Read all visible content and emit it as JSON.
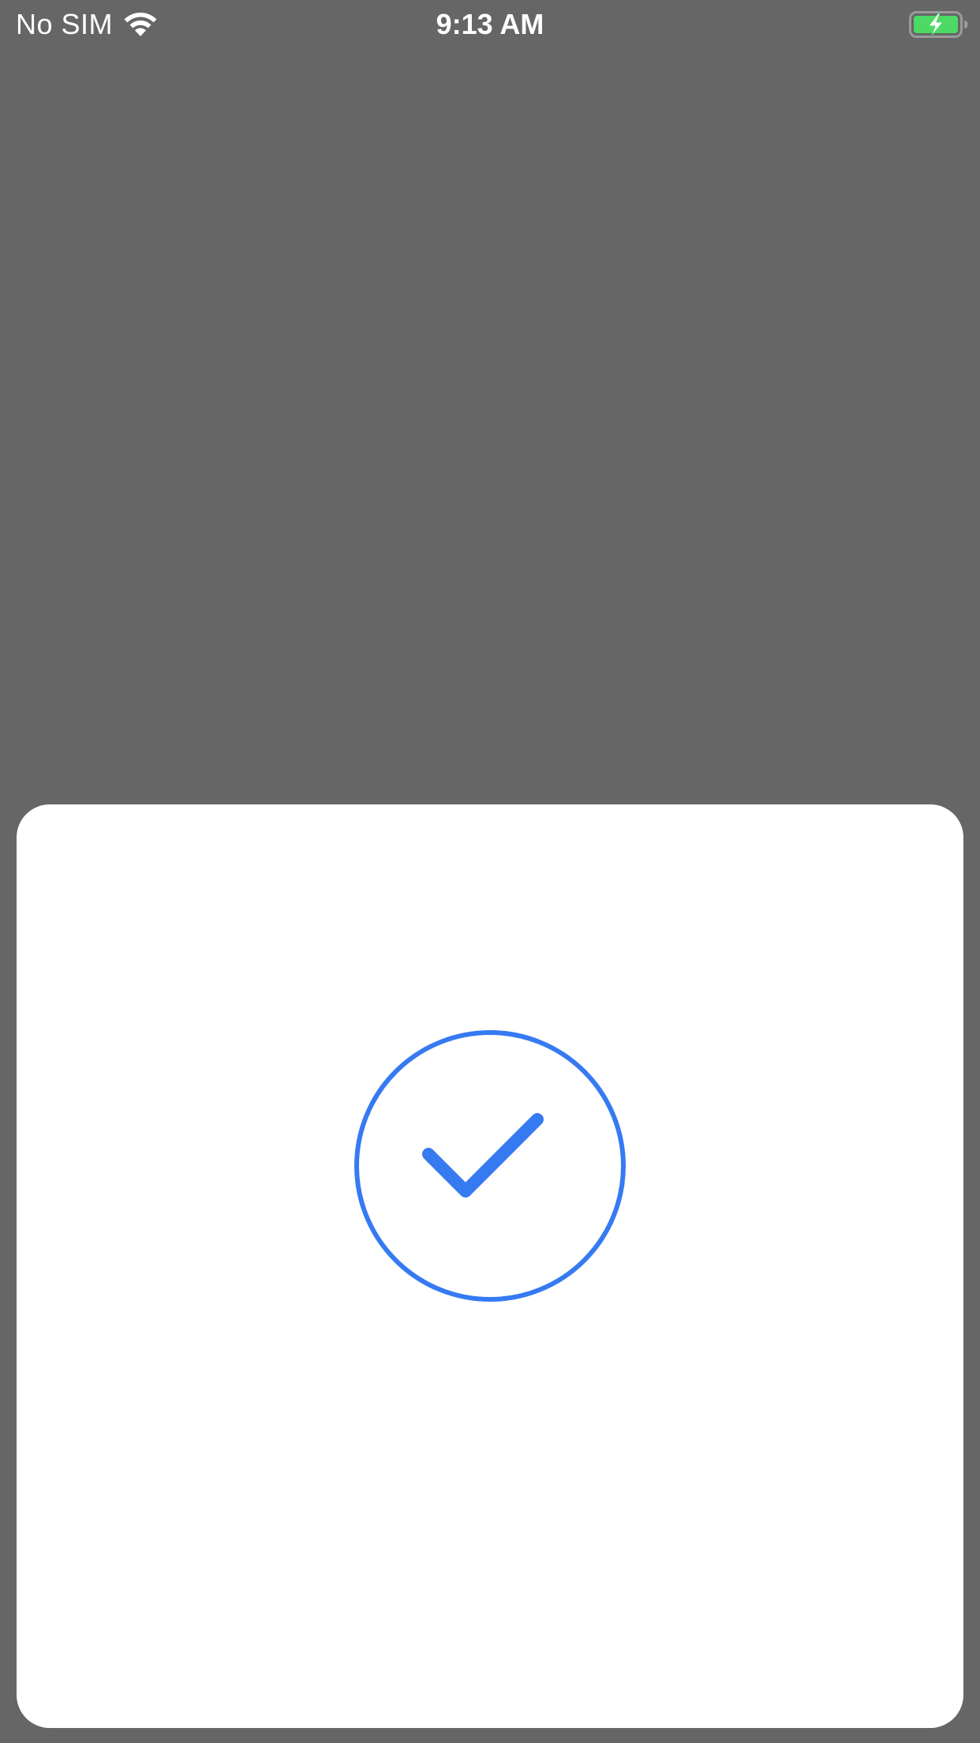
{
  "status_bar": {
    "carrier": "No SIM",
    "time": "9:13 AM",
    "wifi_icon": "wifi-icon",
    "battery_icon": "battery-charging-icon",
    "battery_color": "#4cd964"
  },
  "sheet": {
    "icon": "checkmark-circle-icon",
    "accent_color": "#367af2",
    "background_color": "#ffffff"
  },
  "colors": {
    "overlay": "#666666",
    "status_text": "#ffffff"
  }
}
